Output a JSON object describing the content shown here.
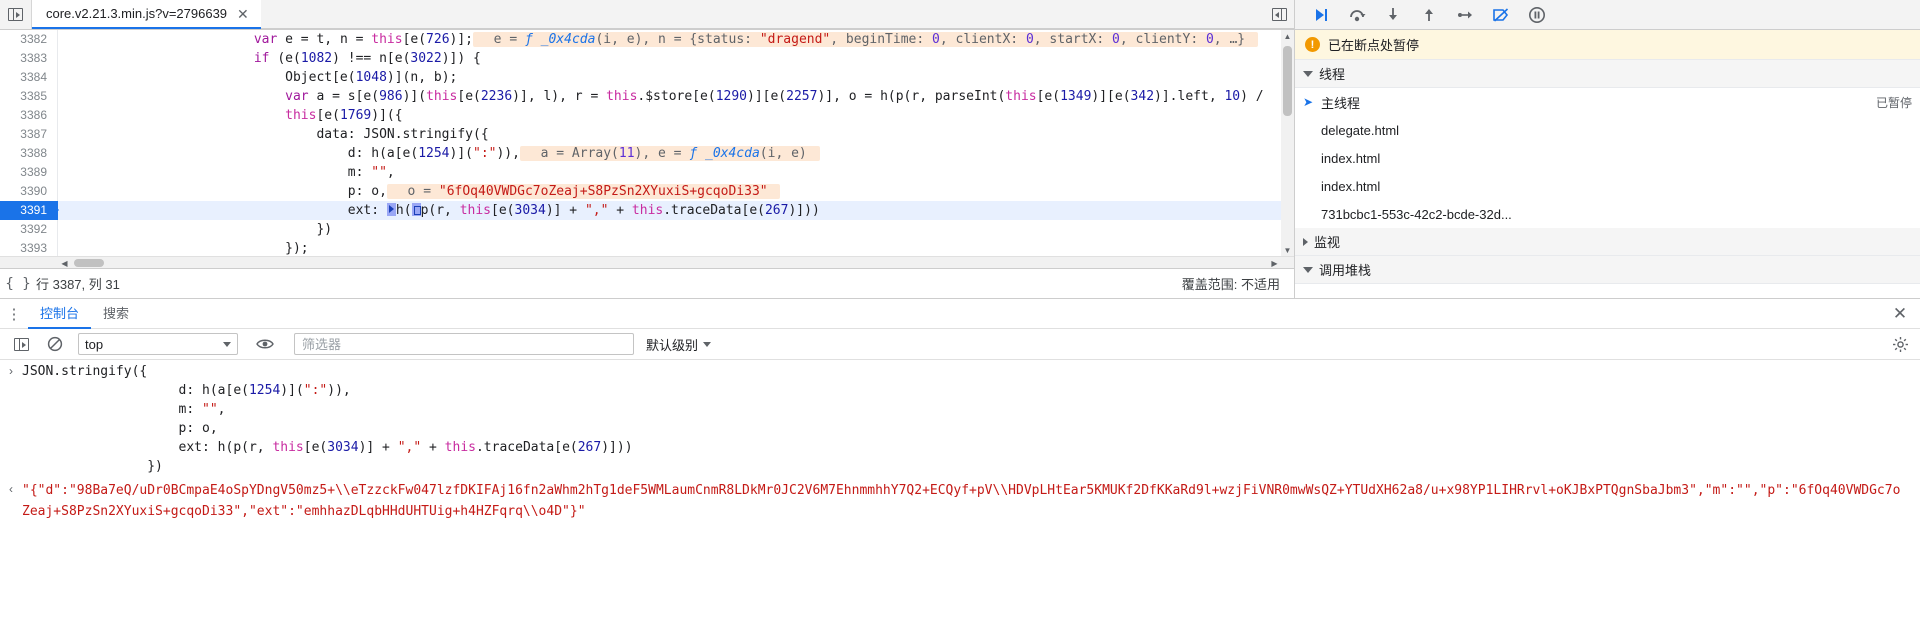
{
  "tab": {
    "title": "core.v2.21.3.min.js?v=2796639",
    "close_label": "✕"
  },
  "debug_toolbar": {
    "resume_label": "resume-script-execution",
    "step_over_label": "step-over-next-function-call",
    "step_into_label": "step-into-next-function-call",
    "step_out_label": "step-out-of-current-function",
    "step_label": "step",
    "deactivate_breakpoints_label": "deactivate-breakpoints",
    "pause_on_exceptions_label": "pause-on-exceptions"
  },
  "editor": {
    "lines": [
      {
        "num": "3382",
        "active": false,
        "indent": 24,
        "code": "var e = t, n = this[e(726)];",
        "eval": "e = ƒ _0x4cda(i, e), n = {status: \"dragend\", beginTime: 0, clientX: 0, startX: 0, clientY: 0, …}"
      },
      {
        "num": "3383",
        "active": false,
        "indent": 24,
        "code": "if (e(1082) !== n[e(3022)]) {",
        "eval": ""
      },
      {
        "num": "3384",
        "active": false,
        "indent": 28,
        "code": "Object[e(1048)](n, b);",
        "eval": ""
      },
      {
        "num": "3385",
        "active": false,
        "indent": 28,
        "code": "var a = s[e(986)](this[e(2236)], l), r = this.$store[e(1290)][e(2257)], o = h(p(r, parseInt(this[e(1349)][e(342)].left, 10) /",
        "eval": ""
      },
      {
        "num": "3386",
        "active": false,
        "indent": 28,
        "code": "this[e(1769)]({",
        "eval": ""
      },
      {
        "num": "3387",
        "active": false,
        "indent": 32,
        "code": "data: JSON.stringify({",
        "eval": ""
      },
      {
        "num": "3388",
        "active": false,
        "indent": 36,
        "code": "d: h(a[e(1254)](\":\")),",
        "eval": "a = Array(11), e = ƒ _0x4cda(i, e)"
      },
      {
        "num": "3389",
        "active": false,
        "indent": 36,
        "code": "m: \"\",",
        "eval": ""
      },
      {
        "num": "3390",
        "active": false,
        "indent": 36,
        "code": "p: o,",
        "eval": "o = \"6fOq40VWDGc7oZeaj+S8PzSn2XYuxiS+gcqoDi33\""
      },
      {
        "num": "3391",
        "active": true,
        "indent": 36,
        "code": "ext: h(p(r, this[e(3034)] + \",\" + this.traceData[e(267)]))",
        "eval": ""
      },
      {
        "num": "3392",
        "active": false,
        "indent": 32,
        "code": "})",
        "eval": ""
      },
      {
        "num": "3393",
        "active": false,
        "indent": 28,
        "code": "});",
        "eval": ""
      },
      {
        "num": "3394",
        "active": false,
        "indent": 24,
        "code": "",
        "eval": ""
      }
    ]
  },
  "editor_status": {
    "format_icon_label": "{ }",
    "position": "行 3387, 列 31",
    "coverage": "覆盖范围: 不适用"
  },
  "sidebar": {
    "paused_banner": "已在断点处暂停",
    "threads_section": "线程",
    "threads": [
      {
        "name": "主线程",
        "status": "已暂停",
        "current": true
      },
      {
        "name": "delegate.html",
        "status": "",
        "current": false
      },
      {
        "name": "index.html",
        "status": "",
        "current": false
      },
      {
        "name": "index.html",
        "status": "",
        "current": false
      },
      {
        "name": "731bcbc1-553c-42c2-bcde-32d...",
        "status": "",
        "current": false
      }
    ],
    "watch_section": "监视",
    "callstack_section": "调用堆栈"
  },
  "console": {
    "tabs": [
      {
        "label": "控制台",
        "selected": true
      },
      {
        "label": "搜索",
        "selected": false
      }
    ],
    "close_label": "✕",
    "context": "top",
    "filter_placeholder": "筛选器",
    "filter_value": "",
    "level": "默认级别",
    "entries": [
      {
        "type": "input",
        "marker": "›",
        "text": "JSON.stringify({\n                    d: h(a[e(1254)](\":\")),\n                    m: \"\",\n                    p: o,\n                    ext: h(p(r, this[e(3034)] + \",\" + this.traceData[e(267)]))\n                })"
      },
      {
        "type": "output",
        "marker": "‹",
        "text": "\"{\"d\":\"98Ba7eQ/uDr0BCmpaE4oSpYDngV50mz5+\\\\eTzzckFw047lzfDKIFAj16fn2aWhm2hTg1deF5WMLaumCnmR8LDkMr0JC2V6M7EhnmmhhY7Q2+ECQyf+pV\\\\HDVpLHtEar5KMUKf2DfKKaRd9l+wzjFiVNR0mwWsQZ+YTUdXH62a8/u+x98YP1LIHRrvl+oKJBxPTQgnSbaJbm3\",\"m\":\"\",\"p\":\"6fOq40VWDGc7oZeaj+S8PzSn2XYuxiS+gcqoDi33\",\"ext\":\"emhhazDLqbHHdUHTUig+h4HZFqrq\\\\o4D\"}\""
      }
    ]
  }
}
